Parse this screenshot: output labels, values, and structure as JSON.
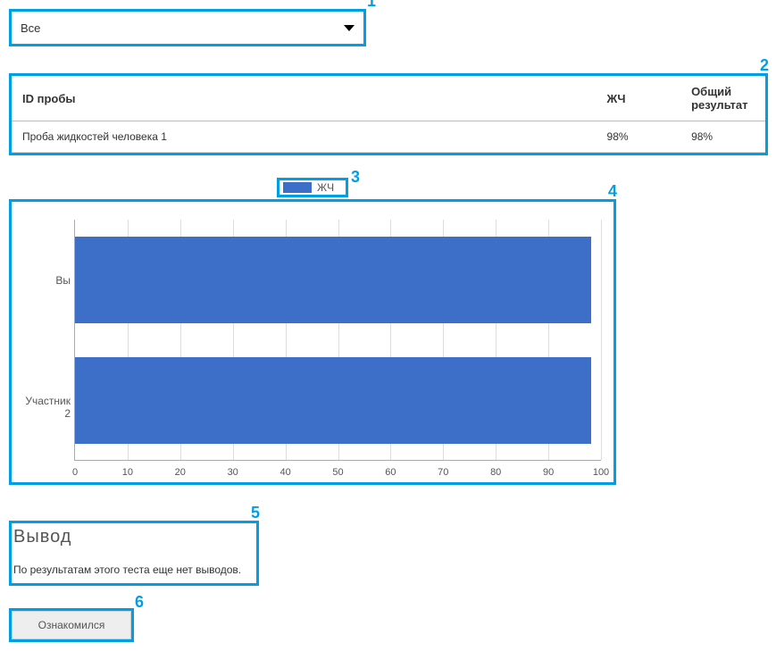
{
  "dropdown": {
    "selected": "Все"
  },
  "table": {
    "headers": {
      "id": "ID пробы",
      "col1": "ЖЧ",
      "col2": "Общий результат"
    },
    "rows": [
      {
        "id": "Проба жидкостей человека 1",
        "col1": "98%",
        "col2": "98%"
      }
    ]
  },
  "legend": {
    "label": "ЖЧ"
  },
  "chart_data": {
    "type": "bar",
    "orientation": "horizontal",
    "categories": [
      "Вы",
      "Участник 2"
    ],
    "series": [
      {
        "name": "ЖЧ",
        "values": [
          98,
          98
        ]
      }
    ],
    "xlabel": "",
    "ylabel": "",
    "xlim": [
      0,
      100
    ],
    "xticks": [
      0,
      10,
      20,
      30,
      40,
      50,
      60,
      70,
      80,
      90,
      100
    ]
  },
  "conclusion": {
    "title": "Вывод",
    "text": "По результатам этого теста еще нет выводов."
  },
  "button": {
    "ack": "Ознакомился"
  },
  "annotations": {
    "a1": "1",
    "a2": "2",
    "a3": "3",
    "a4": "4",
    "a5": "5",
    "a6": "6"
  }
}
